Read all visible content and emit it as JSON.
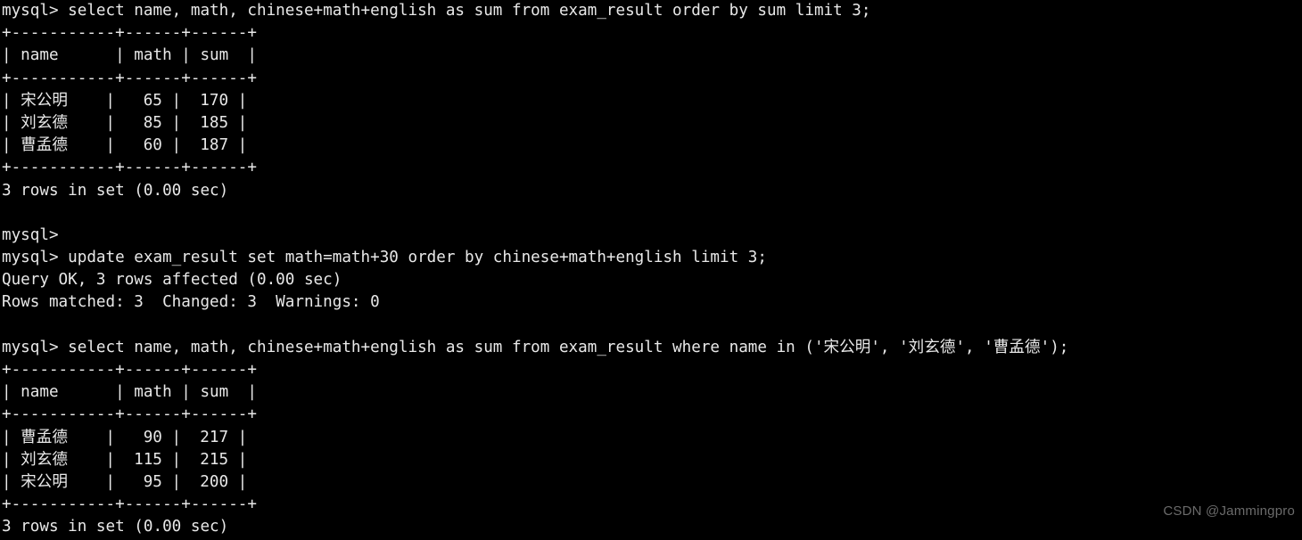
{
  "terminal": {
    "app": "mysql-client",
    "prompt": "mysql>",
    "background_color": "#000000",
    "text_color": "#e8e8e8",
    "lines": [
      "mysql> select name, math, chinese+math+english as sum from exam_result order by sum limit 3;",
      "+-----------+------+------+",
      "| name      | math | sum  |",
      "+-----------+------+------+",
      "| 宋公明    |   65 |  170 |",
      "| 刘玄德    |   85 |  185 |",
      "| 曹孟德    |   60 |  187 |",
      "+-----------+------+------+",
      "3 rows in set (0.00 sec)",
      "",
      "mysql>",
      "mysql> update exam_result set math=math+30 order by chinese+math+english limit 3;",
      "Query OK, 3 rows affected (0.00 sec)",
      "Rows matched: 3  Changed: 3  Warnings: 0",
      "",
      "mysql> select name, math, chinese+math+english as sum from exam_result where name in ('宋公明', '刘玄德', '曹孟德');",
      "+-----------+------+------+",
      "| name      | math | sum  |",
      "+-----------+------+------+",
      "| 曹孟德    |   90 |  217 |",
      "| 刘玄德    |  115 |  215 |",
      "| 宋公明    |   95 |  200 |",
      "+-----------+------+------+",
      "3 rows in set (0.00 sec)"
    ],
    "queries": [
      {
        "sql": "select name, math, chinese+math+english as sum from exam_result order by sum limit 3;",
        "status": "3 rows in set (0.00 sec)",
        "table": {
          "columns": [
            "name",
            "math",
            "sum"
          ],
          "rows": [
            [
              "宋公明",
              "65",
              "170"
            ],
            [
              "刘玄德",
              "85",
              "185"
            ],
            [
              "曹孟德",
              "60",
              "187"
            ]
          ]
        }
      },
      {
        "sql": "update exam_result set math=math+30 order by chinese+math+english limit 3;",
        "status": "Query OK, 3 rows affected (0.00 sec)",
        "detail": "Rows matched: 3  Changed: 3  Warnings: 0"
      },
      {
        "sql": "select name, math, chinese+math+english as sum from exam_result where name in ('宋公明', '刘玄德', '曹孟德');",
        "status": "3 rows in set (0.00 sec)",
        "table": {
          "columns": [
            "name",
            "math",
            "sum"
          ],
          "rows": [
            [
              "曹孟德",
              "90",
              "217"
            ],
            [
              "刘玄德",
              "115",
              "215"
            ],
            [
              "宋公明",
              "95",
              "200"
            ]
          ]
        }
      }
    ]
  },
  "watermark": {
    "text": "CSDN @Jammingpro",
    "color": "#6b6b6b"
  }
}
